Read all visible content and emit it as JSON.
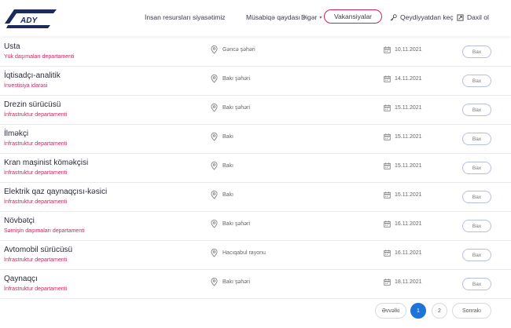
{
  "header": {
    "logo_text": "ADY",
    "nav": {
      "hr_policy": "İnsan resursları siyasətimiz",
      "competition_rules": "Müsabiqə qaydası",
      "other": "Digər",
      "vacancies": "Vakansiyalar",
      "register": "Qeydiyyatdan keç",
      "login": "Daxil ol"
    },
    "accent_color": "#d11f5f"
  },
  "vacancies": [
    {
      "title": "Usta",
      "department": "Yük daşımaları departamenti",
      "location": "Gəncə şəhəri",
      "date": "10.11.2021",
      "action": "Bax"
    },
    {
      "title": "İqtisadçı-analitik",
      "department": "İnvestisiya idarəsi",
      "location": "Bakı şəhəri",
      "date": "14.11.2021",
      "action": "Bax"
    },
    {
      "title": "Drezin sürücüsü",
      "department": "İnfrastruktur departamenti",
      "location": "Bakı şəhəri",
      "date": "15.11.2021",
      "action": "Bax"
    },
    {
      "title": "İlməkçi",
      "department": "İnfrastruktur departamenti",
      "location": "Bakı",
      "date": "15.11.2021",
      "action": "Bax"
    },
    {
      "title": "Kran maşinist köməkçisi",
      "department": "İnfrastruktur departamenti",
      "location": "Bakı",
      "date": "15.11.2021",
      "action": "Bax"
    },
    {
      "title": "Elektrik qaz qaynaqçısı-kəsici",
      "department": "İnfrastruktur departamenti",
      "location": "Bakı",
      "date": "15.11.2021",
      "action": "Bax"
    },
    {
      "title": "Növbətçi",
      "department": "Sərnişin daşımaları departamenti",
      "location": "Bakı şəhəri",
      "date": "16.11.2021",
      "action": "Bax"
    },
    {
      "title": "Avtomobil sürücüsü",
      "department": "İnfrastruktur departamenti",
      "location": "Hacıqabul rayonu",
      "date": "16.11.2021",
      "action": "Bax"
    },
    {
      "title": "Qaynaqçı",
      "department": "İnfrastruktur departamenti",
      "location": "Bakı şəhəri",
      "date": "18.11.2021",
      "action": "Bax"
    }
  ],
  "pagination": {
    "prev": "Əvvəlki",
    "pages": [
      "1",
      "2"
    ],
    "current": "1",
    "next": "Sonrakı",
    "active_color": "#1e73d6"
  }
}
